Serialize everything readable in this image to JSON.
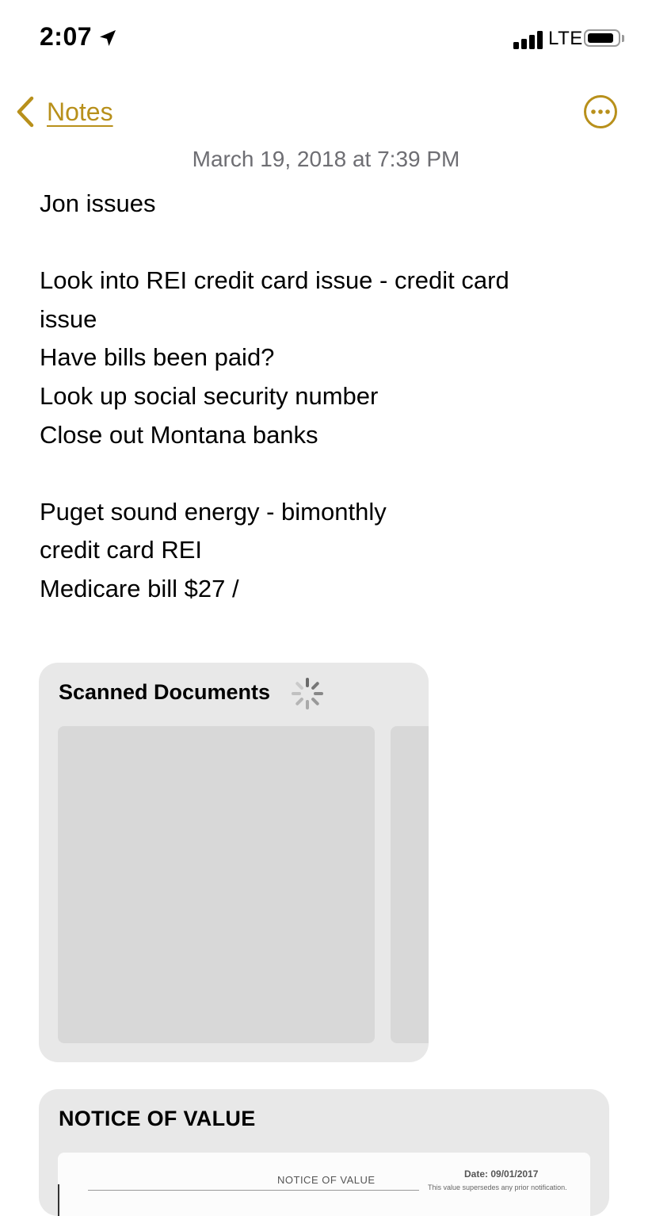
{
  "status_bar": {
    "time": "2:07",
    "network": "LTE",
    "battery_level": 0.9,
    "signal_bars": 4
  },
  "nav": {
    "back_label": "Notes",
    "accent_color": "#b8901b"
  },
  "note": {
    "date": "March 19, 2018 at 7:39 PM",
    "lines": [
      "Jon issues",
      "",
      "Look into REI credit card issue - credit card",
      "issue",
      "Have bills been paid?",
      "Look up social security number",
      "Close out Montana banks",
      "",
      "Puget sound energy - bimonthly",
      "credit card REI",
      "Medicare bill $27 /"
    ]
  },
  "attachments": {
    "scanned": {
      "title": "Scanned Documents",
      "loading": true
    },
    "notice": {
      "title": "NOTICE OF VALUE",
      "preview_heading": "NOTICE OF VALUE",
      "preview_date": "Date: 09/01/2017",
      "preview_subtext": "This value supersedes any prior notification."
    }
  },
  "icons": {
    "location": "location-arrow-icon",
    "back": "chevron-left-icon",
    "more": "ellipsis-circle-icon",
    "spinner": "activity-spinner-icon"
  }
}
